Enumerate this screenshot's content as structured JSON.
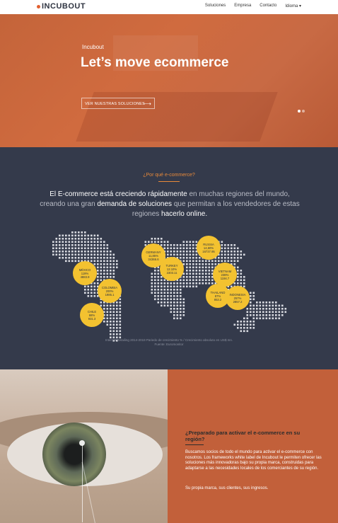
{
  "nav": {
    "logo": "INCUBOUT",
    "links": [
      "Soluciones",
      "Empresa",
      "Contacto",
      "Idioma ▾"
    ]
  },
  "hero": {
    "kicker": "Incubout",
    "title": "Let’s move ecommerce",
    "button": "VER NUESTRAS SOLUCIONES",
    "button_icon": "arrow-right-icon"
  },
  "why": {
    "kicker": "¿Por qué e-commerce?",
    "text_1": "El E-commerce está creciendo rápidamente",
    "text_2": " en muchas regiones del mundo, creando una gran ",
    "text_3": "demanda de soluciones",
    "text_4": " que permitan a los vendedores de estas regiones ",
    "text_5": "hacerlo online.",
    "bubbles": [
      {
        "country": "MÉXICO",
        "growth": "119%",
        "value": "4883.9"
      },
      {
        "country": "COLOMBIA",
        "growth": "200%",
        "value": "1985.1"
      },
      {
        "country": "CHILE",
        "growth": "68%",
        "value": "931.3"
      },
      {
        "country": "GERMANY",
        "growth": "11,85%",
        "value": "34366.6"
      },
      {
        "country": "TURKEY",
        "growth": "12.10%",
        "value": "2303.11"
      },
      {
        "country": "RUSSIA",
        "growth": "14,60%",
        "value": "16737.95"
      },
      {
        "country": "VIETNAM",
        "growth": "238%",
        "value": "1194.7"
      },
      {
        "country": "THAILAND",
        "growth": "87%",
        "value": "853.2"
      },
      {
        "country": "INDONESIA",
        "growth": "257%",
        "value": "2857.2"
      }
    ],
    "source_1": "Internet Retailing 2014-2019 Pariedo de crecimiento % / Crecimiento absoluto en US$ mn.",
    "source_2": "Fuente: Euromonitor"
  },
  "cta": {
    "title": "¿Preparado para activar el e-commerce en su región?",
    "body": "Buscamos socios de todo el mundo para activar el e-commerce con nosotros. Los frameworks white label de Incubout le permiten ofrecer las soluciones más innovadoras bajo su propia marca, construidas para adaptarse a las necesidades locales de los comerciantes de su región.",
    "footer": "Su propia marca, sus clientes, sus ingresos."
  }
}
